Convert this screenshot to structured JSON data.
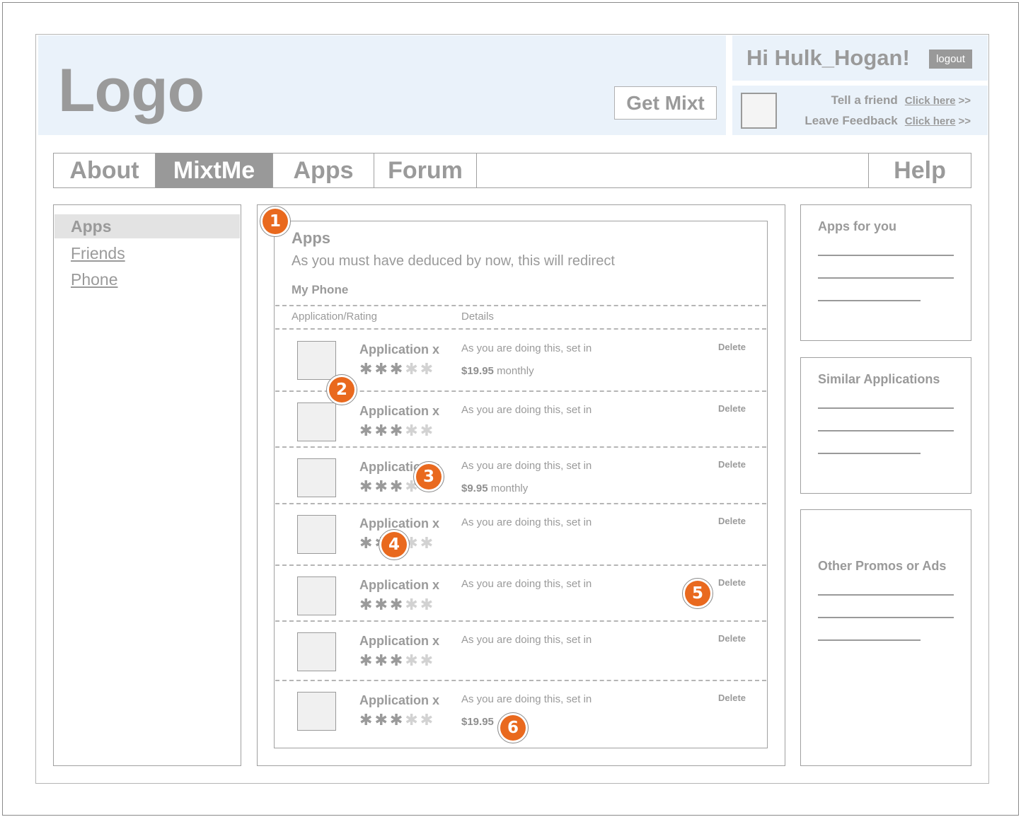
{
  "header": {
    "logo": "Logo",
    "get_mixt": "Get Mixt",
    "greeting": "Hi Hulk_Hogan!",
    "logout": "logout",
    "tell_friend": "Tell a friend",
    "leave_feedback": "Leave Feedback",
    "click_here": "Click here",
    "arrow": ">>"
  },
  "nav": {
    "tabs": [
      {
        "label": "About",
        "active": false
      },
      {
        "label": "MixtMe",
        "active": true
      },
      {
        "label": "Apps",
        "active": false
      },
      {
        "label": "Forum",
        "active": false
      }
    ],
    "help": "Help"
  },
  "sidebar": {
    "items": [
      {
        "label": "Apps",
        "active": true
      },
      {
        "label": "Friends",
        "active": false
      },
      {
        "label": "Phone",
        "active": false
      }
    ]
  },
  "main": {
    "title": "Apps",
    "description": "As you must have deduced by now, this will redirect",
    "section": "My Phone",
    "col_app": "Application/Rating",
    "col_details": "Details",
    "rows": [
      {
        "name": "Application x",
        "rating": 3,
        "max": 5,
        "detail": "As you are doing this, set in",
        "price": "$19.95",
        "period": "monthly",
        "delete": "Delete"
      },
      {
        "name": "Application x",
        "rating": 3,
        "max": 5,
        "detail": "As you are doing this, set in",
        "price": "",
        "period": "",
        "delete": "Delete"
      },
      {
        "name": "Application x",
        "rating": 3,
        "max": 5,
        "detail": "As you are doing this, set in",
        "price": "$9.95",
        "period": "monthly",
        "delete": "Delete"
      },
      {
        "name": "Application x",
        "rating": 3,
        "max": 5,
        "detail": "As you are doing this, set in",
        "price": "",
        "period": "",
        "delete": "Delete"
      },
      {
        "name": "Application x",
        "rating": 3,
        "max": 5,
        "detail": "As you are doing this, set in",
        "price": "",
        "period": "",
        "delete": "Delete"
      },
      {
        "name": "Application x",
        "rating": 3,
        "max": 5,
        "detail": "As you are doing this, set in",
        "price": "",
        "period": "",
        "delete": "Delete"
      },
      {
        "name": "Application x",
        "rating": 3,
        "max": 5,
        "detail": "As you are doing this, set in",
        "price": "$19.95",
        "period": "",
        "delete": "Delete"
      }
    ]
  },
  "right": {
    "apps_for_you": "Apps for you",
    "similar": "Similar Applications",
    "promos": "Other Promos or Ads"
  },
  "callouts": [
    "1",
    "2",
    "3",
    "4",
    "5",
    "6"
  ],
  "colors": {
    "accent": "#e9691e",
    "header_bg": "#eaf2fa",
    "active_tab": "#999999"
  }
}
